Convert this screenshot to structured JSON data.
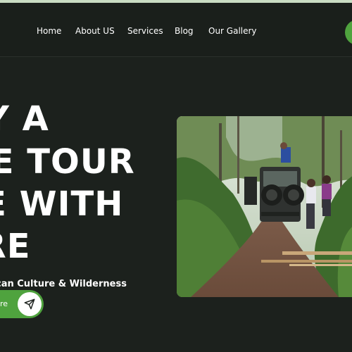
{
  "nav": {
    "items": [
      "Home",
      "About US",
      "Services",
      "Blog",
      "Our Gallery"
    ]
  },
  "hero": {
    "lines": [
      "OY A",
      "ME TOUR",
      "VE WITH",
      "ERE"
    ],
    "subtitle": "can Culture & Wilderness",
    "cta_label": "re",
    "image_alt": "Safari jeep on a forest dirt road"
  },
  "colors": {
    "background": "#1c211d",
    "accent": "#4fa33e",
    "top_strip": "#c9dcc3"
  },
  "icons": {
    "cta": "paper-plane-icon"
  }
}
